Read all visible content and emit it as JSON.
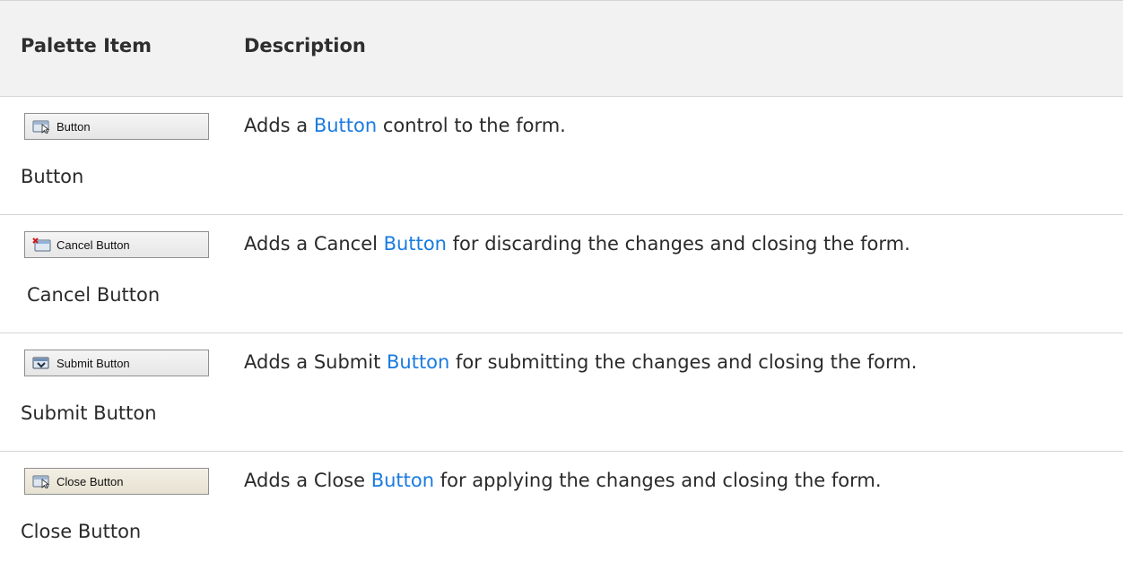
{
  "header": {
    "palette_item": "Palette Item",
    "description": "Description"
  },
  "rows": [
    {
      "button_label": "Button",
      "icon": "button-window-icon",
      "item_name": "Button",
      "desc_before": "Adds a ",
      "desc_link": "Button",
      "desc_after": " control to the form."
    },
    {
      "button_label": "Cancel Button",
      "icon": "cancel-window-icon",
      "item_name": "Cancel Button",
      "desc_before": "Adds a Cancel ",
      "desc_link": "Button",
      "desc_after": " for discarding the changes and closing the form."
    },
    {
      "button_label": "Submit Button",
      "icon": "submit-window-icon",
      "item_name": "Submit Button",
      "desc_before": "Adds a Submit ",
      "desc_link": "Button",
      "desc_after": " for submitting the changes and closing the form."
    },
    {
      "button_label": "Close Button",
      "icon": "close-window-icon",
      "item_name": "Close Button",
      "desc_before": "Adds a Close ",
      "desc_link": "Button",
      "desc_after": " for applying the changes and closing the form."
    }
  ],
  "colors": {
    "link": "#1a7be0",
    "header_bg": "#f2f2f2",
    "rule": "#d4d4d4"
  }
}
